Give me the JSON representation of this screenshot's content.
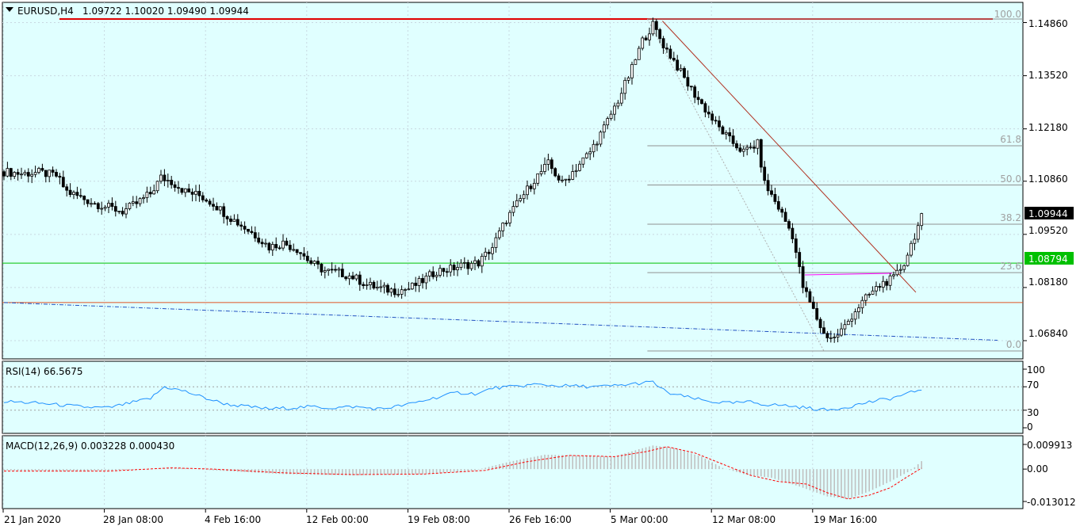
{
  "header": {
    "symbol": "EURUSD,H4",
    "ohlc": "1.09722 1.10020 1.09490 1.09944"
  },
  "colors": {
    "background": "#e0ffff",
    "candle": "#000000",
    "resistance": "#e00000",
    "trendline": "#b03020",
    "green_line": "#00c000",
    "orange_line": "#e05020",
    "ma": "#2050c0",
    "fib": "#909090",
    "rsi": "#1e90ff",
    "macd_hist": "#c0c0c0",
    "macd_signal": "#ff0000",
    "magenta": "#ff00ff"
  },
  "price_axis": {
    "ticks": [
      "1.14860",
      "1.13520",
      "1.12180",
      "1.10860",
      "1.09520",
      "1.08180",
      "1.06840"
    ],
    "current_price": "1.09944",
    "green_level": "1.08794"
  },
  "fibonacci": {
    "levels": [
      "100.0",
      "61.8",
      "50.0",
      "38.2",
      "23.6",
      "0.0"
    ]
  },
  "time_axis": {
    "labels": [
      "21 Jan 2020",
      "28 Jan 08:00",
      "4 Feb 16:00",
      "12 Feb 00:00",
      "19 Feb 08:00",
      "26 Feb 16:00",
      "5 Mar 00:00",
      "12 Mar 08:00",
      "19 Mar 16:00"
    ]
  },
  "rsi_panel": {
    "title": "RSI(14) 66.5675",
    "levels": [
      "100",
      "70",
      "30",
      "0"
    ]
  },
  "macd_panel": {
    "title": "MACD(12,26,9) 0.003228 0.000430",
    "levels": [
      "0.009913",
      "0.00",
      "-0.013012"
    ]
  },
  "chart_data": {
    "type": "candlestick",
    "symbol": "EURUSD",
    "timeframe": "H4",
    "last_ohlc": {
      "open": 1.09722,
      "high": 1.1002,
      "low": 1.0949,
      "close": 1.09944
    },
    "ylim": [
      1.063,
      1.152
    ],
    "price_path": [
      [
        0,
        1.111
      ],
      [
        5,
        1.1105
      ],
      [
        10,
        1.1108
      ],
      [
        15,
        1.11
      ],
      [
        18,
        1.106
      ],
      [
        22,
        1.1045
      ],
      [
        26,
        1.103
      ],
      [
        30,
        1.102
      ],
      [
        34,
        1.101
      ],
      [
        38,
        1.103
      ],
      [
        42,
        1.1055
      ],
      [
        45,
        1.1095
      ],
      [
        48,
        1.1085
      ],
      [
        52,
        1.106
      ],
      [
        56,
        1.105
      ],
      [
        60,
        1.103
      ],
      [
        64,
        1.1
      ],
      [
        68,
        1.0975
      ],
      [
        72,
        1.095
      ],
      [
        76,
        1.092
      ],
      [
        80,
        1.093
      ],
      [
        84,
        1.0915
      ],
      [
        88,
        1.088
      ],
      [
        92,
        1.086
      ],
      [
        96,
        1.0855
      ],
      [
        100,
        1.0845
      ],
      [
        104,
        1.0825
      ],
      [
        108,
        1.0815
      ],
      [
        112,
        1.081
      ],
      [
        116,
        1.0815
      ],
      [
        120,
        1.0835
      ],
      [
        124,
        1.086
      ],
      [
        128,
        1.0865
      ],
      [
        132,
        1.0875
      ],
      [
        136,
        1.088
      ],
      [
        140,
        1.092
      ],
      [
        144,
        1.099
      ],
      [
        148,
        1.104
      ],
      [
        152,
        1.109
      ],
      [
        156,
        1.113
      ],
      [
        160,
        1.108
      ],
      [
        164,
        1.112
      ],
      [
        168,
        1.116
      ],
      [
        172,
        1.122
      ],
      [
        176,
        1.129
      ],
      [
        180,
        1.137
      ],
      [
        183,
        1.144
      ],
      [
        186,
        1.148
      ],
      [
        189,
        1.143
      ],
      [
        192,
        1.139
      ],
      [
        196,
        1.133
      ],
      [
        200,
        1.128
      ],
      [
        204,
        1.123
      ],
      [
        208,
        1.119
      ],
      [
        212,
        1.116
      ],
      [
        216,
        1.118
      ],
      [
        218,
        1.108
      ],
      [
        222,
        1.102
      ],
      [
        226,
        1.095
      ],
      [
        229,
        1.082
      ],
      [
        232,
        1.076
      ],
      [
        235,
        1.07
      ],
      [
        238,
        1.069
      ],
      [
        241,
        1.072
      ],
      [
        244,
        1.076
      ],
      [
        248,
        1.08
      ],
      [
        252,
        1.083
      ],
      [
        255,
        1.084
      ],
      [
        258,
        1.088
      ],
      [
        261,
        1.095
      ],
      [
        263,
        1.0994
      ]
    ],
    "moving_average": [
      [
        0,
        1.078
      ],
      [
        263,
        1.0685
      ]
    ],
    "horizontal_levels": {
      "resistance": 1.1495,
      "green": 1.08794,
      "orange": 1.078
    },
    "trendline": [
      [
        186,
        1.149
      ],
      [
        263,
        1.081
      ]
    ],
    "fibonacci": {
      "x_start": 186,
      "high": 1.1495,
      "low": 1.0658,
      "levels": [
        100.0,
        61.8,
        50.0,
        38.2,
        23.6,
        0.0
      ]
    },
    "rsi": {
      "period": 14,
      "last": 66.5675,
      "levels": [
        100,
        70,
        30,
        0
      ],
      "path": [
        [
          0,
          45
        ],
        [
          10,
          42
        ],
        [
          18,
          38
        ],
        [
          24,
          35
        ],
        [
          30,
          34
        ],
        [
          36,
          42
        ],
        [
          42,
          50
        ],
        [
          46,
          70
        ],
        [
          52,
          62
        ],
        [
          58,
          50
        ],
        [
          64,
          40
        ],
        [
          70,
          36
        ],
        [
          76,
          32
        ],
        [
          82,
          34
        ],
        [
          88,
          36
        ],
        [
          94,
          34
        ],
        [
          100,
          36
        ],
        [
          108,
          32
        ],
        [
          116,
          40
        ],
        [
          124,
          52
        ],
        [
          130,
          60
        ],
        [
          136,
          58
        ],
        [
          140,
          68
        ],
        [
          146,
          70
        ],
        [
          152,
          74
        ],
        [
          158,
          72
        ],
        [
          164,
          71
        ],
        [
          170,
          70
        ],
        [
          176,
          72
        ],
        [
          182,
          76
        ],
        [
          186,
          78
        ],
        [
          190,
          60
        ],
        [
          196,
          52
        ],
        [
          202,
          45
        ],
        [
          208,
          42
        ],
        [
          214,
          44
        ],
        [
          218,
          40
        ],
        [
          224,
          38
        ],
        [
          230,
          34
        ],
        [
          236,
          30
        ],
        [
          242,
          36
        ],
        [
          248,
          44
        ],
        [
          254,
          50
        ],
        [
          259,
          58
        ],
        [
          263,
          66.5675
        ]
      ]
    },
    "macd": {
      "params": [
        12,
        26,
        9
      ],
      "main": 0.003228,
      "signal": 0.00043,
      "levels": [
        0.009913,
        0.0,
        -0.013012
      ],
      "hist_path": [
        [
          0,
          -0.0005
        ],
        [
          20,
          -0.0008
        ],
        [
          40,
          -0.0002
        ],
        [
          50,
          0.0005
        ],
        [
          60,
          -0.0005
        ],
        [
          80,
          -0.002
        ],
        [
          100,
          -0.0025
        ],
        [
          120,
          -0.002
        ],
        [
          135,
          -0.0005
        ],
        [
          145,
          0.003
        ],
        [
          155,
          0.0058
        ],
        [
          165,
          0.0055
        ],
        [
          175,
          0.005
        ],
        [
          182,
          0.008
        ],
        [
          186,
          0.0095
        ],
        [
          192,
          0.0085
        ],
        [
          200,
          0.005
        ],
        [
          206,
          0.0005
        ],
        [
          212,
          -0.002
        ],
        [
          220,
          -0.0035
        ],
        [
          228,
          -0.007
        ],
        [
          236,
          -0.011
        ],
        [
          242,
          -0.012
        ],
        [
          248,
          -0.009
        ],
        [
          254,
          -0.005
        ],
        [
          260,
          -0.0005
        ],
        [
          263,
          0.0032
        ]
      ],
      "signal_path": [
        [
          0,
          -0.0008
        ],
        [
          30,
          -0.0008
        ],
        [
          48,
          0.0005
        ],
        [
          60,
          0.0
        ],
        [
          80,
          -0.0015
        ],
        [
          100,
          -0.0022
        ],
        [
          120,
          -0.002
        ],
        [
          138,
          -0.0005
        ],
        [
          150,
          0.003
        ],
        [
          162,
          0.0055
        ],
        [
          175,
          0.005
        ],
        [
          184,
          0.007
        ],
        [
          190,
          0.009
        ],
        [
          198,
          0.0065
        ],
        [
          206,
          0.002
        ],
        [
          214,
          -0.0025
        ],
        [
          222,
          -0.005
        ],
        [
          230,
          -0.006
        ],
        [
          236,
          -0.0095
        ],
        [
          242,
          -0.012
        ],
        [
          248,
          -0.0105
        ],
        [
          254,
          -0.0075
        ],
        [
          259,
          -0.003
        ],
        [
          263,
          0.0004
        ]
      ]
    }
  }
}
